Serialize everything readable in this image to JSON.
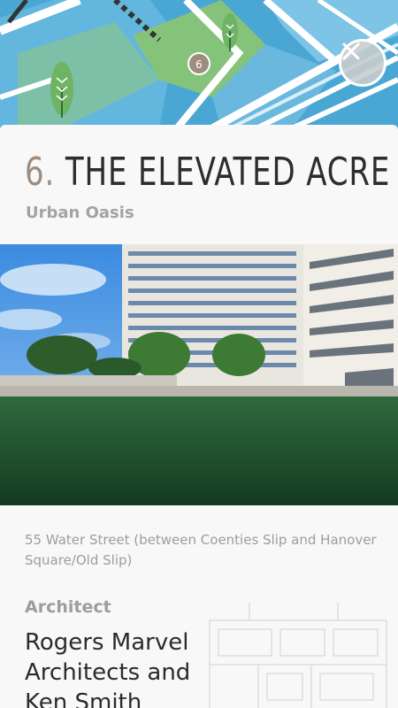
{
  "map": {
    "marker_label": "6"
  },
  "close_button": {
    "label": "close"
  },
  "site": {
    "number": "6.",
    "name": "THE ELEVATED ACRE",
    "subtitle": "Urban Oasis",
    "address": "55 Water Street (between Coenties Slip and Hanover Square/Old Slip)",
    "architect_label": "Architect",
    "architect_value": "Rogers Marvel Architects and Ken Smith"
  },
  "colors": {
    "number_accent": "#9e8c7e",
    "title": "#2d2d2d",
    "muted_text": "#a3a3a3",
    "map_water": "#5fb3d9",
    "map_park": "#7fbf6a"
  },
  "icons": {
    "close": "close-icon",
    "tree": "tree-icon",
    "marker": "map-marker-icon"
  }
}
